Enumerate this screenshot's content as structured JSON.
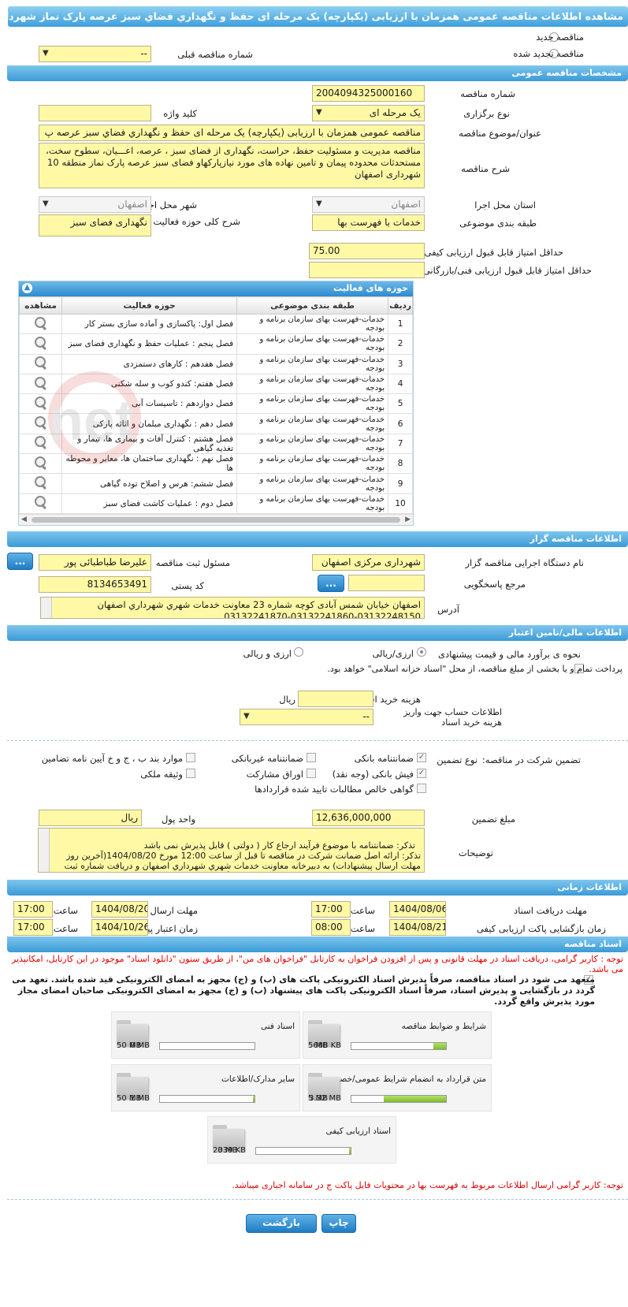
{
  "title": "مشاهده اطلاعات مناقصه عمومی همزمان با ارزیابی (یکپارچه) یک مرحله ای حفظ و نگهداري فضاي سبز عرصه پارک نماز شهردار اصفهان",
  "top": {
    "radio_new": "مناقصه جدید",
    "radio_renewed": "مناقصه تجدید شده",
    "prev_number_label": "شماره مناقصه قبلی",
    "prev_number_value": "--"
  },
  "general": {
    "header": "مشخصات مناقصه عمومی",
    "number_label": "شماره مناقصه",
    "number_value": "2004094325000160",
    "type_label": "نوع برگزاری",
    "type_value": "یک مرحله ای",
    "keyword_label": "کلید واژه",
    "keyword_value": "",
    "subject_label": "عنوان/موضوع مناقصه",
    "subject_value": "مناقصه عمومی همزمان با ارزیابی (یکپارچه) یک مرحله ای  حفظ و نگهداري فضاي سبز عرصه پ",
    "desc_label": "شرح مناقصه",
    "desc_value": "مناقصه مدیریت و مسئولیت حفظ، حراست، نگهداری از فضای سبز ، عرصه، اعـــیان، سطوح سخت، مستحدثات محدوده پیمان و تامین نهاده های مورد نیازپارکهاو فضای سبز عرصه پارک نماز منطقه 10 شهرداری اصفهان",
    "province_label": "استان محل اجرا",
    "province_value": "اصفهان",
    "city_label": "شهر محل اجرا",
    "city_value": "اصفهان",
    "category_label": "طبقه بندی موضوعی",
    "category_value": "خدمات با فهرست بها",
    "activity_label": "شرح کلی حوزه فعالیت",
    "activity_value": "نگهداری فضای سبز",
    "min_quality_label": "حداقل امتیاز قابل قبول ارزیابی کیفی",
    "min_quality_value": "75.00",
    "min_tech_label": "حداقل امتیاز قابل قبول ارزیابی فنی/بازرگانی",
    "min_tech_value": ""
  },
  "scope": {
    "header": "حوزه های فعالیت",
    "columns": [
      "ردیف",
      "طبقه بندی موضوعی",
      "حوزه فعالیت",
      "مشاهده"
    ],
    "rows": [
      {
        "n": "1",
        "cat": "خدمات-فهرست بهای سازمان برنامه و بودجه",
        "act": "فصل اول:  پاکسازی و آماده سازی بستر کار"
      },
      {
        "n": "2",
        "cat": "خدمات-فهرست بهای سازمان برنامه و بودجه",
        "act": "فصل پنجم : عملیات حفظ و نگهداری فضای سبز"
      },
      {
        "n": "3",
        "cat": "خدمات-فهرست بهای سازمان برنامه و بودجه",
        "act": "فصل هفدهم : کارهای دستمزدی"
      },
      {
        "n": "4",
        "cat": "خدمات-فهرست بهای سازمان برنامه و بودجه",
        "act": "فصل هفتم: کندو کوب و سله شکنی"
      },
      {
        "n": "5",
        "cat": "خدمات-فهرست بهای سازمان برنامه و بودجه",
        "act": "فصل دوازدهم : تاسیسات آبی"
      },
      {
        "n": "6",
        "cat": "خدمات-فهرست بهای سازمان برنامه و بودجه",
        "act": "فصل دهم : نگهداری مبلمان و اثاثه پارکی"
      },
      {
        "n": "7",
        "cat": "خدمات-فهرست بهای سازمان برنامه و بودجه",
        "act": "فصل هشتم : کنترل آفات و بیماری ها، تیمار و تغذیه گیاهی"
      },
      {
        "n": "8",
        "cat": "خدمات-فهرست بهای سازمان برنامه و بودجه",
        "act": "فصل نهم : نگهداری ساختمان ها، معابر و محوطه ها"
      },
      {
        "n": "9",
        "cat": "خدمات-فهرست بهای سازمان برنامه و بودجه",
        "act": "فصل ششم: هرس و اصلاح توده گیاهی"
      },
      {
        "n": "10",
        "cat": "خدمات-فهرست بهای سازمان برنامه و بودجه",
        "act": "فصل دوم : عملیات کاشت فضای سبز"
      }
    ]
  },
  "organizer": {
    "header": "اطلاعات مناقصه گزار",
    "org_label": "نام دستگاه اجرایی مناقصه گزار",
    "org_value": "شهرداری مرکزی اصفهان",
    "resp_label": "مسئول ثبت مناقصه",
    "resp_value": "علیرضا طباطبائی پور",
    "ref_label": "مرجع پاسخگویی",
    "ref_value": "",
    "postal_label": "کد پستی",
    "postal_value": "8134653491",
    "address_label": "آدرس",
    "address_value": "اصفهان  خیابان شمس آبادی کوچه شماره 23 معاونت خدمات شهري شهرداري اصفهان  03132248150-03132241860-03132241870",
    "dots": "..."
  },
  "finance": {
    "header": "اطلاعات مالی/تامین اعتبار",
    "estimate_label": "نحوه ی برآورد مالی و قیمت پیشنهادی",
    "opt_rial": "ارزی/ریالی",
    "opt_foreign": "ارزی و ریالی",
    "islamic_label": "پرداخت تمام و یا بخشی از مبلغ مناقصه، از محل \"اسناد خزانه اسلامی\" خواهد بود.",
    "doc_cost_label": "هزینه خرید اسناد",
    "doc_cost_unit": "ریال",
    "account_label": "اطلاعات حساب جهت واریز هزینه خرید اسناد",
    "account_value": "--"
  },
  "guarantee": {
    "section_label": "تضمین شرکت در مناقصه:",
    "type_label": "نوع تضمین",
    "options": [
      "ضمانتنامه بانکی",
      "ضمانتنامه غیربانکی",
      "موارد بند ب ، ج و خ آیین نامه تضامین",
      "فیش بانکی (وجه نقد)",
      "اوراق مشارکت",
      "وثیقه ملکی",
      "گواهی خالص مطالبات تایید شده قراردادها"
    ],
    "amount_label": "مبلغ تضمین",
    "amount_value": "12,636,000,000",
    "currency_label": "واحد پول",
    "currency_value": "ریال",
    "notes_label": "توضیحات",
    "notes_value": "تذکر: ضمانتنامه با موضوع فرآیند ارجاع کار ( دولتی ) قابل پذیرش نمی باشد\nتذکر: ارائه اصل ضمانت شرکت در مناقصه تا قبل از ساعت 12:00 مورخ 1404/08/20(آخرین روز مهلت ارسال پیشنهادات) به دبیرخانه معاونت خدمات شهري شهرداري اصفهان و دریافت شماره ثبت الزامی بوده و در غیر این صورت کسر مدارک در نظر گرفته شده و پاکات الف ، ب و ج مفتوح نخواهد شد."
  },
  "timing": {
    "header": "اطلاعات زمانی",
    "doc_receive_label": "مهلت دریافت اسناد",
    "doc_receive_date": "1404/08/06",
    "doc_receive_time": "17:00",
    "send_label": "مهلت ارسال پاکتهای پیشنهاد",
    "send_date": "1404/08/20",
    "send_time": "17:00",
    "open_label": "زمان بازگشایی پاکت ارزیابی کیفی",
    "open_date": "1404/08/21",
    "open_time": "08:00",
    "valid_label": "زمان اعتبار پیشنهاد",
    "valid_date": "1404/10/26",
    "valid_time": "17:00",
    "time_label": "ساعت"
  },
  "docs": {
    "header": "اسناد مناقصه",
    "note1": "توجه : کاربر گرامی، دریافت اسناد در مهلت قانونی و پس از افزودن فراخوان به کارتابل \"فراخوان های من\"، از طریق ستون \"دانلود اسناد\" موجود در این کارتابل، امکانپذیر می باشد.",
    "note2": "متعهد می شود در اسناد مناقصه، صرفاً پذیرش اسناد الکترونیکی پاکت های (ب) و (ج) مجهز به امضای الکترونیکی قید شده باشد. تعهد می گردد در بازگشایی و پذیرش اسناد، صرفاً اسناد الکترونیکی پاکت های پیشنهاد (ب) و (ج) مجهز به امضای الکترونیکی صاحبان امضای مجاز مورد پذیرش واقع گردد.",
    "files": [
      {
        "title": "شرایط و ضوابط مناقصه",
        "size": "688 KB",
        "max": "5 MB",
        "fill": 0.13
      },
      {
        "title": "اسناد فنی",
        "size": "0 MB",
        "max": "50 MB",
        "fill": 0.0
      },
      {
        "title": "متن قرارداد به انضمام شرایط عمومی/خصوصی",
        "size": "3.32 MB",
        "max": "5 MB",
        "fill": 0.66
      },
      {
        "title": "سایر مدارک/اطلاعات",
        "size": "1 MB",
        "max": "50 MB",
        "fill": 0.02
      },
      {
        "title": "اسناد ارزیابی کیفی",
        "size": "339 KB",
        "max": "20 MB",
        "fill": 0.02
      }
    ],
    "note3": "توجه: کاربر گرامی ارسال اطلاعات مربوط به فهرست بها در محتویات فایل پاکت ج در سامانه اجباری میباشد."
  },
  "buttons": {
    "back": "بازگشت",
    "print": "چاپ"
  },
  "watermark": "IranTender.net"
}
